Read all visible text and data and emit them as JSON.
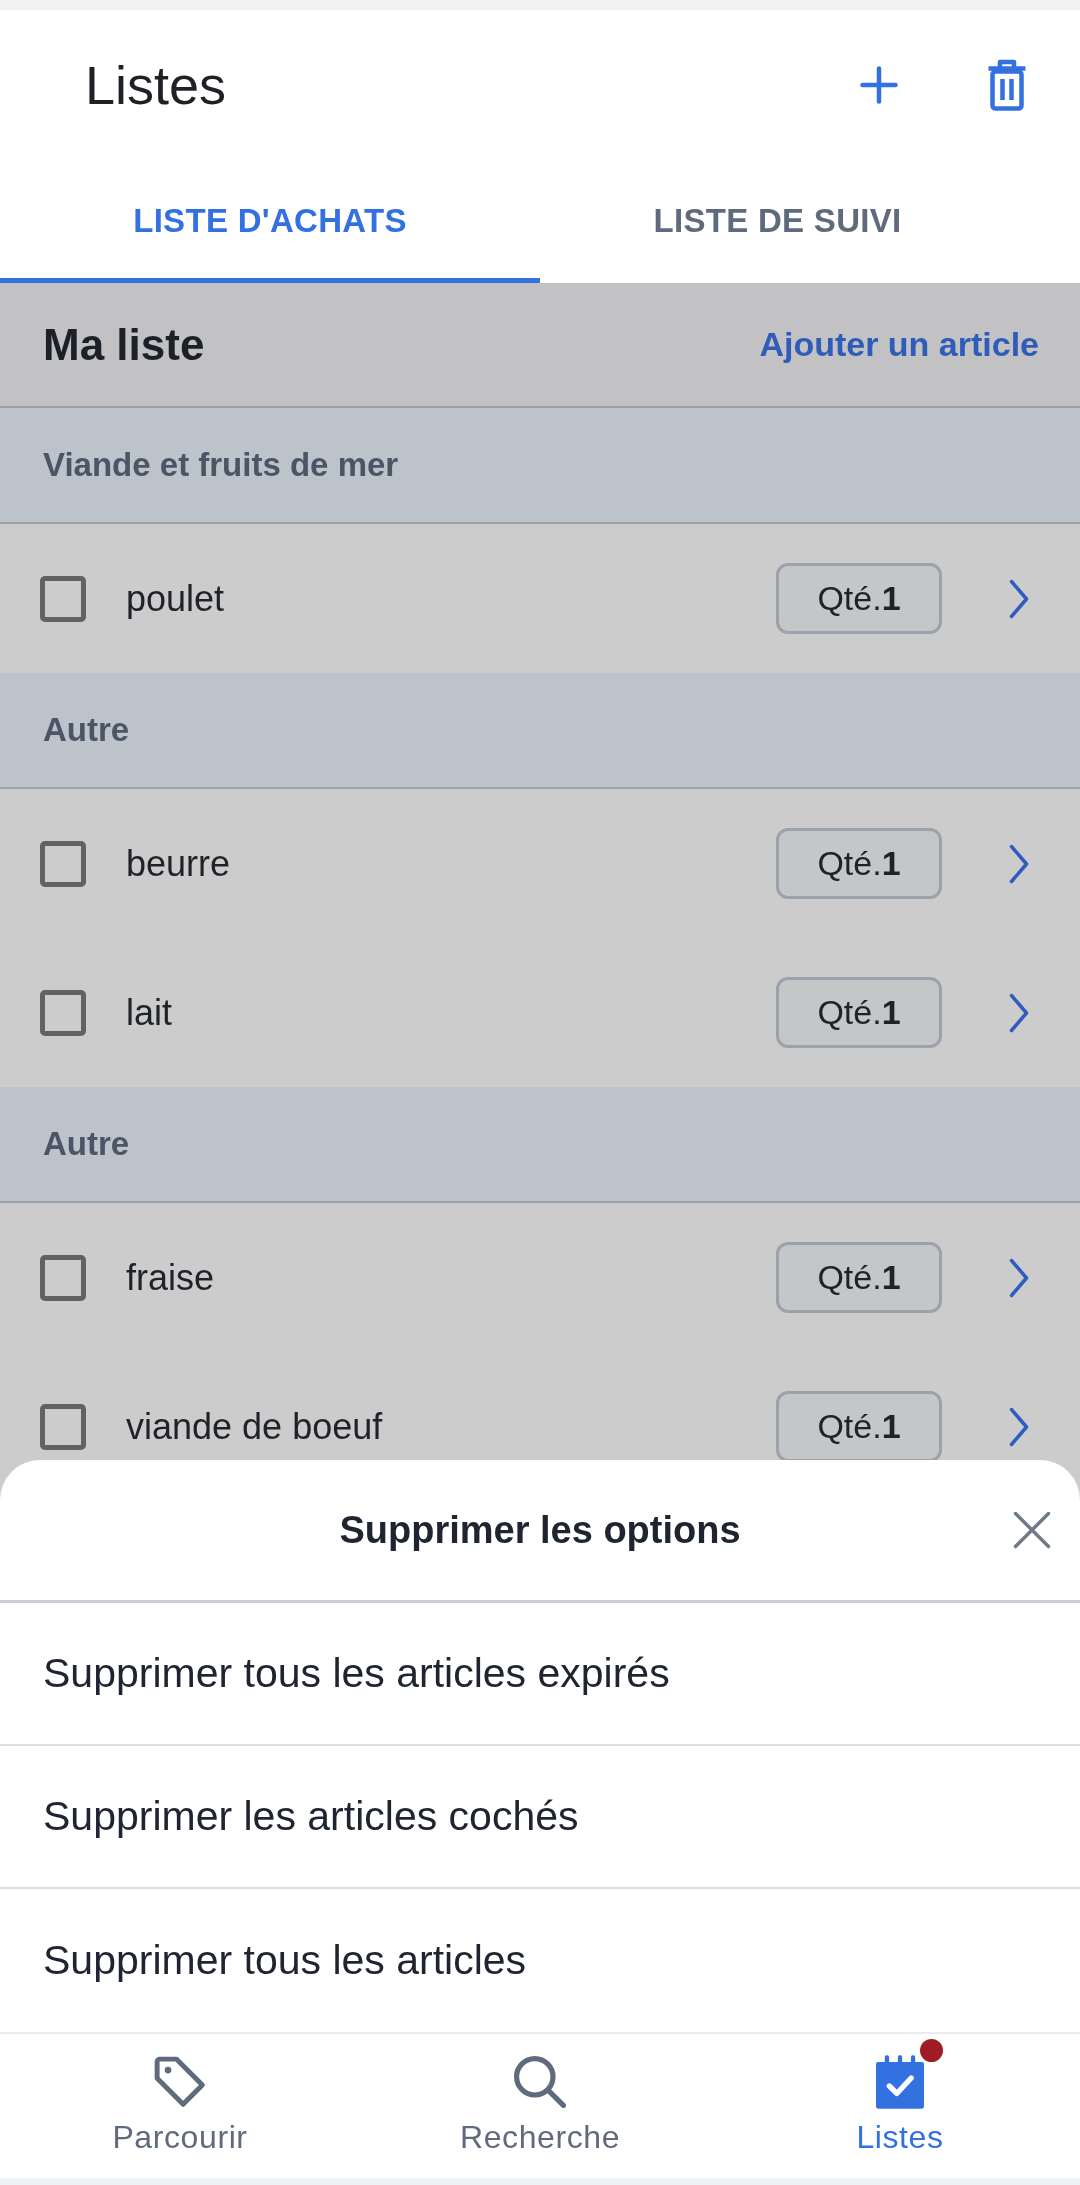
{
  "header": {
    "title": "Listes"
  },
  "tabs": [
    {
      "label": "LISTE D'ACHATS",
      "selected": true
    },
    {
      "label": "LISTE DE SUIVI",
      "selected": false
    }
  ],
  "list": {
    "title": "Ma liste",
    "add_link": "Ajouter un article",
    "sections": [
      {
        "name": "Viande et fruits de mer",
        "items": [
          {
            "name": "poulet",
            "checked": false,
            "quantity": "Qté.**1**"
          }
        ]
      },
      {
        "name": "Autre",
        "items": [
          {
            "name": "beurre",
            "checked": false,
            "quantity": "Qté.**1**"
          },
          {
            "name": "lait",
            "checked": false,
            "quantity": "Qté.**1**"
          }
        ]
      },
      {
        "name": "Autre",
        "items": [
          {
            "name": "fraise",
            "checked": false,
            "quantity": "Qté.**1**"
          },
          {
            "name": "viande de boeuf",
            "checked": false,
            "quantity": "Qté.**1**"
          }
        ]
      }
    ]
  },
  "sheet": {
    "title": "Supprimer les options",
    "options": [
      "Supprimer tous les articles expirés",
      "Supprimer les articles cochés",
      "Supprimer tous les articles"
    ]
  },
  "bottom_nav": [
    {
      "kind": "browse",
      "label": "Parcourir",
      "selected": false,
      "badge": false
    },
    {
      "kind": "search",
      "label": "Recherche",
      "selected": false,
      "badge": false
    },
    {
      "kind": "lists",
      "label": "Listes",
      "selected": true,
      "badge": true
    }
  ]
}
